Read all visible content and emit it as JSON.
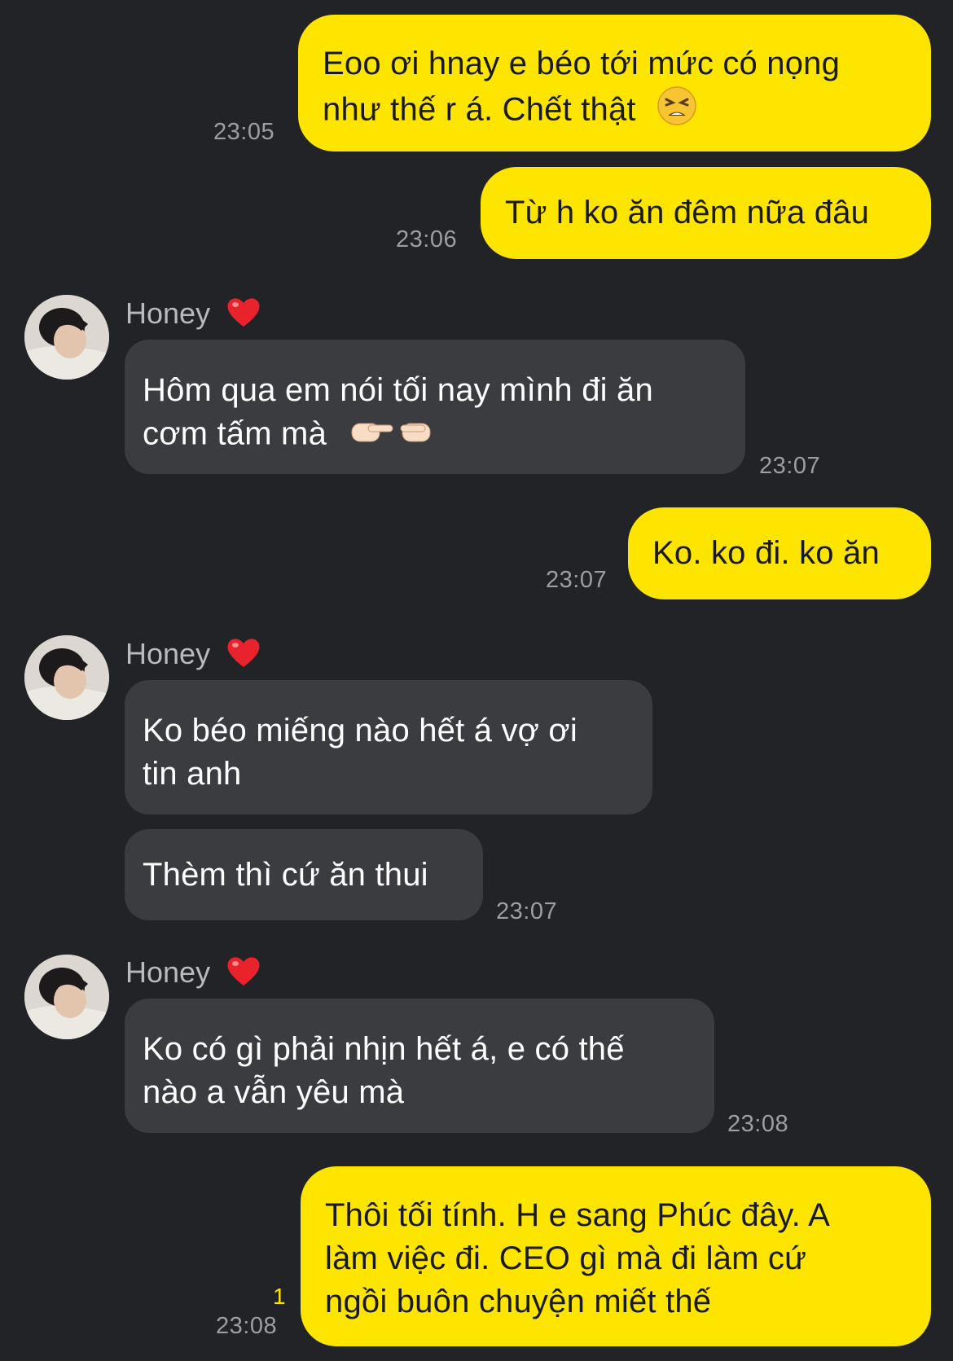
{
  "messages": [
    {
      "id": "m1",
      "direction": "out",
      "lines": [
        "Eoo ơi hnay e béo tới mức có nọng",
        "như thế r á. Chết thật"
      ],
      "emoji": "weary-face-emoji",
      "time": "23:05"
    },
    {
      "id": "m2",
      "direction": "out",
      "lines": [
        "Từ h ko ăn đêm nữa đâu"
      ],
      "time": "23:06"
    },
    {
      "id": "m3",
      "direction": "in",
      "sender": "Honey",
      "sender_emoji": "red-heart-emoji",
      "lines": [
        "Hôm qua em nói tối nay mình đi ăn",
        "cơm tấm mà"
      ],
      "emoji": "pointing-fingers-emoji",
      "time": "23:07"
    },
    {
      "id": "m4",
      "direction": "out",
      "lines": [
        "Ko. ko đi. ko ăn"
      ],
      "time": "23:07"
    },
    {
      "id": "m5",
      "direction": "in",
      "sender": "Honey",
      "sender_emoji": "red-heart-emoji",
      "lines": [
        "Ko béo miếng nào hết á vợ ơi",
        "tin anh"
      ]
    },
    {
      "id": "m6",
      "direction": "in",
      "lines": [
        "Thèm thì cứ ăn thui"
      ],
      "time": "23:07"
    },
    {
      "id": "m7",
      "direction": "in",
      "sender": "Honey",
      "sender_emoji": "red-heart-emoji",
      "lines": [
        "Ko có gì phải nhịn hết á, e có thế",
        "nào a vẫn yêu mà"
      ],
      "time": "23:08"
    },
    {
      "id": "m8",
      "direction": "out",
      "lines": [
        "Thôi tối tính. H e sang Phúc đây. A",
        "làm việc đi. CEO gì mà đi làm cứ",
        "ngồi buôn chuyện miết thế"
      ],
      "unread": "1",
      "time": "23:08"
    }
  ],
  "colors": {
    "background": "#222326",
    "outgoing_bubble": "#fee500",
    "incoming_bubble": "#3b3c40",
    "timestamp": "#9d9ea3",
    "unread_count": "#fee500"
  }
}
